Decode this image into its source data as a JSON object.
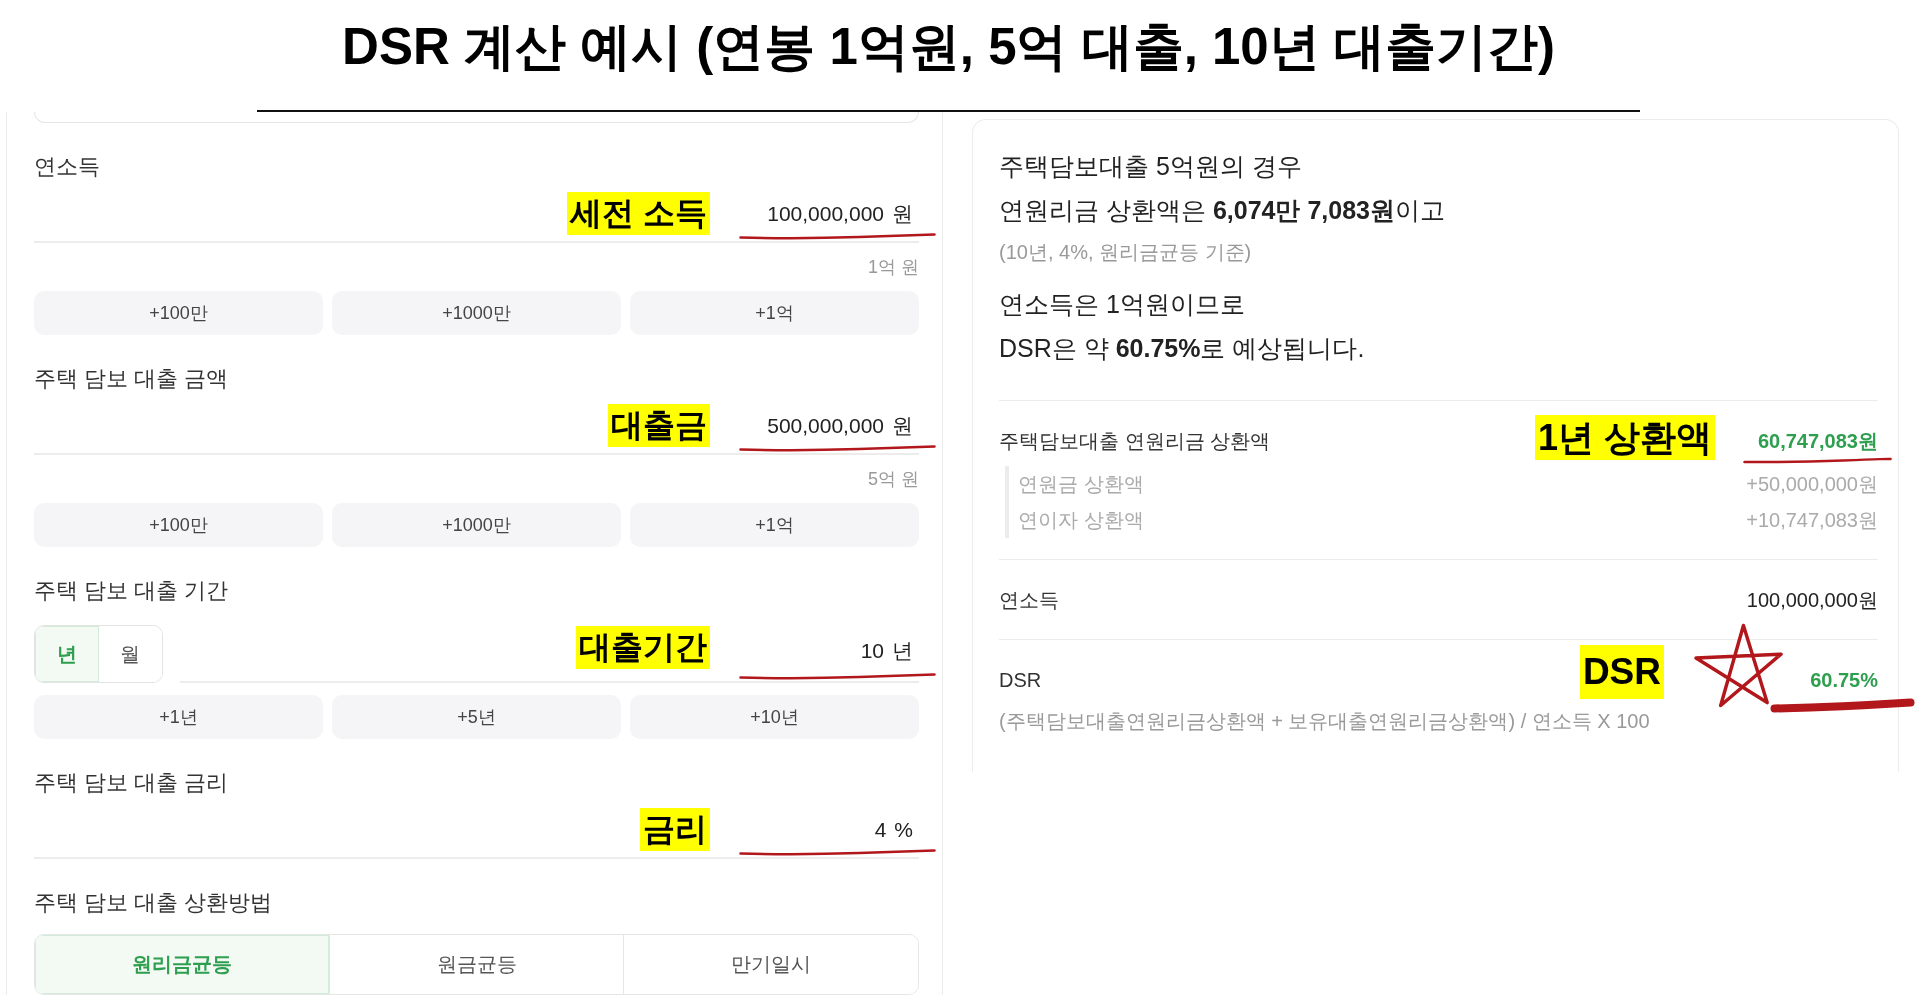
{
  "title": "DSR 계산 예시 (연봉 1억원, 5억 대출, 10년 대출기간)",
  "inputs": [
    {
      "kind": "number",
      "label": "연소득",
      "annotation": "세전 소득",
      "value": "100,000,000",
      "unit": "원",
      "underlined": true,
      "hint": "1억 원",
      "quick_buttons": [
        "+100만",
        "+1000만",
        "+1억"
      ]
    },
    {
      "kind": "number",
      "label": "주택 담보 대출 금액",
      "annotation": "대출금",
      "value": "500,000,000",
      "unit": "원",
      "underlined": true,
      "hint": "5억 원",
      "quick_buttons": [
        "+100만",
        "+1000만",
        "+1억"
      ]
    },
    {
      "kind": "number",
      "label": "주택 담보 대출 기간",
      "units": [
        {
          "label": "년",
          "selected": true
        },
        {
          "label": "월",
          "selected": false
        }
      ],
      "annotation": "대출기간",
      "value": "10",
      "unit": "년",
      "underlined": true,
      "quick_buttons": [
        "+1년",
        "+5년",
        "+10년"
      ]
    },
    {
      "kind": "number",
      "label": "주택 담보 대출 금리",
      "annotation": "금리",
      "value": "4",
      "unit": "%",
      "underlined": true
    },
    {
      "kind": "segmented",
      "label": "주택 담보 대출 상환방법",
      "options": [
        {
          "label": "원리금균등",
          "selected": true
        },
        {
          "label": "원금균등",
          "selected": false
        },
        {
          "label": "만기일시",
          "selected": false
        }
      ]
    }
  ],
  "summary": {
    "lines": [
      {
        "kind": "main",
        "text": "주택담보대출 5억원의 경우"
      },
      {
        "kind": "main",
        "text": "연원리금 상환액은 **6,074만 7,083원**이고"
      },
      {
        "kind": "note",
        "text": "(10년, 4%, 원리금균등 기준)"
      },
      {
        "kind": "main",
        "text": "연소득은 1억원이므로"
      },
      {
        "kind": "main",
        "text": "DSR은 약 **60.75%**로 예상됩니다."
      }
    ],
    "rows": [
      {
        "label": "주택담보대출 연원리금 상환액",
        "value": "60,747,083원",
        "accent": true,
        "annotation": "1년 상환액",
        "underline": {
          "kind": "pen"
        },
        "starred": false,
        "children": [
          {
            "label": "연원금 상환액",
            "value": "+50,000,000원"
          },
          {
            "label": "연이자 상환액",
            "value": "+10,747,083원"
          }
        ]
      },
      {
        "label": "연소득",
        "value": "100,000,000원",
        "accent": false,
        "starred": false
      },
      {
        "label": "DSR",
        "value": "60.75%",
        "accent": true,
        "annotation": "DSR",
        "underline": {
          "kind": "brush"
        },
        "starred": true,
        "note": "(주택담보대출연원리금상환액 + 보유대출연원리금상환액) / 연소득 X 100"
      }
    ]
  }
}
